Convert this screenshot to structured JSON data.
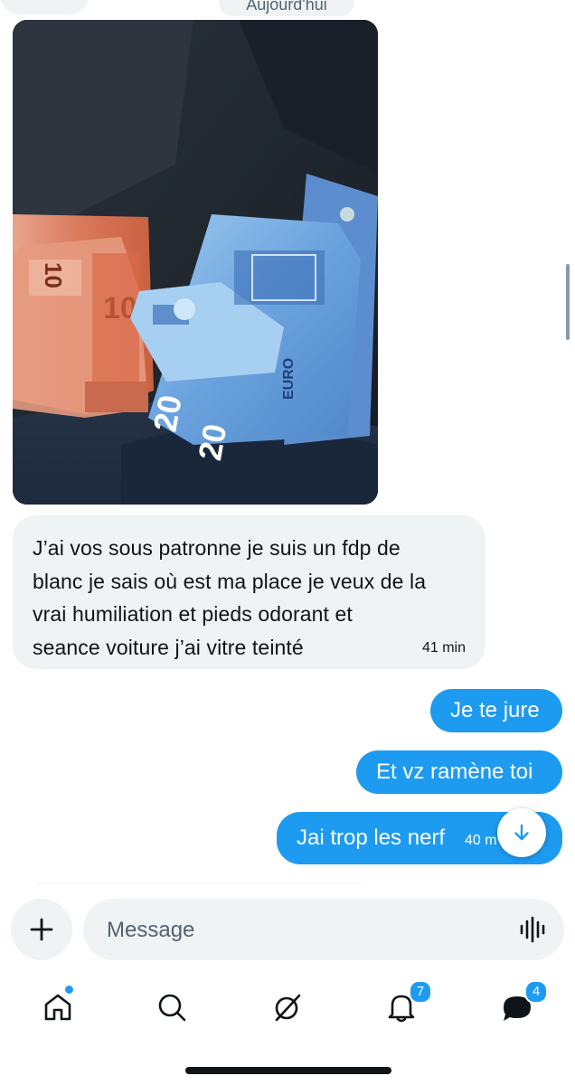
{
  "header": {
    "date_separator": "Aujourd'hui"
  },
  "messages": {
    "received": {
      "text": "J’ai vos sous patronne je suis un fdp de\nblanc je sais où est ma place je veux de la\nvrai humiliation et pieds odorant et\nseance voiture j’ai vitre teinté",
      "time": "41 min"
    },
    "sent": [
      {
        "text": "Je te jure"
      },
      {
        "text": "Et vz ramène toi"
      },
      {
        "text": "Jai trop les nerf",
        "time": "40 m"
      }
    ]
  },
  "photo": {
    "note_denominations": [
      "10",
      "20",
      "20"
    ],
    "currency_label": "EURO"
  },
  "composer": {
    "placeholder": "Message"
  },
  "nav": {
    "notifications_count": "7",
    "messages_count": "4"
  },
  "colors": {
    "accent": "#1d9bf0",
    "bubble_in": "#eff3f4",
    "text": "#0f1419"
  },
  "icons": [
    "plus-icon",
    "voice-icon",
    "home-icon",
    "search-icon",
    "grok-icon",
    "bell-icon",
    "messages-icon",
    "arrow-down-icon"
  ]
}
